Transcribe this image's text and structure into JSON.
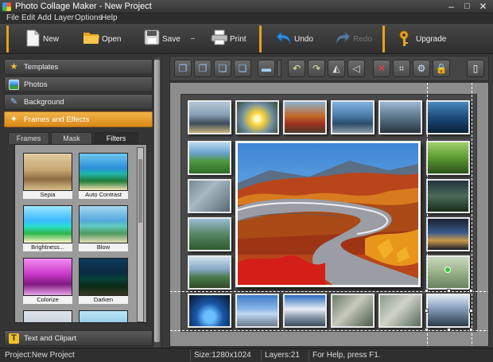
{
  "window": {
    "title": "Photo Collage Maker - New Project",
    "minimize": "–",
    "maximize": "□",
    "close": "✕"
  },
  "menu": [
    "File",
    "Edit",
    "Add",
    "Layer",
    "Options",
    "Help"
  ],
  "toolbar": {
    "new": "New",
    "open": "Open",
    "save": "Save",
    "print": "Print",
    "undo": "Undo",
    "redo": "Redo",
    "upgrade": "Upgrade"
  },
  "sidebar": {
    "sections": [
      "Templates",
      "Photos",
      "Background",
      "Frames and Effects"
    ],
    "active_section": "Frames and Effects",
    "bottom_section": "Text and Clipart",
    "tabs": [
      "Frames",
      "Mask",
      "Filters"
    ],
    "active_tab": "Filters",
    "filters": [
      "Sepia",
      "Auto Contrast",
      "Brightness...",
      "Blow",
      "Colorize",
      "Darken",
      "",
      ""
    ]
  },
  "canvas_tools": [
    "bring-to-front",
    "bring-forward",
    "send-backward",
    "send-to-back",
    "align",
    "rotate-left",
    "rotate-right",
    "flip-horizontal",
    "flip-vertical",
    "delete",
    "crop",
    "settings",
    "lock",
    "page"
  ],
  "status": {
    "project": "Project:New Project",
    "size": "Size:1280x1024",
    "layers": "Layers:21",
    "help": "For Help, press F1."
  },
  "colors": {
    "accent": "#e8a020",
    "active_section": "#e59a2a",
    "panel": "#353535"
  }
}
